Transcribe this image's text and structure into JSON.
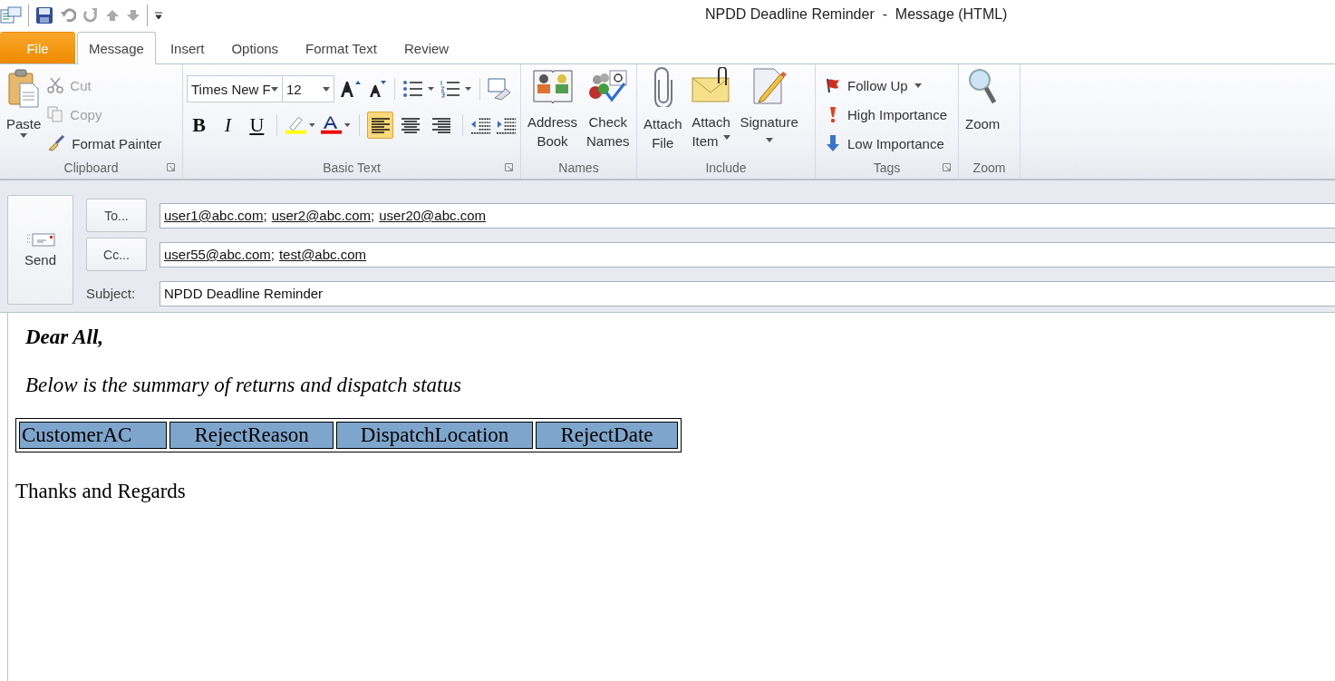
{
  "window": {
    "title": "NPDD Deadline Reminder  -  Message (HTML)"
  },
  "tabs": [
    {
      "label": "File",
      "kind": "file",
      "selected": false
    },
    {
      "label": "Message",
      "kind": "tab",
      "selected": true
    },
    {
      "label": "Insert",
      "kind": "tab",
      "selected": false
    },
    {
      "label": "Options",
      "kind": "tab",
      "selected": false
    },
    {
      "label": "Format Text",
      "kind": "tab",
      "selected": false
    },
    {
      "label": "Review",
      "kind": "tab",
      "selected": false
    }
  ],
  "clipboard": {
    "label": "Clipboard",
    "paste": "Paste",
    "items": [
      {
        "label": "Cut",
        "disabled": true
      },
      {
        "label": "Copy",
        "disabled": true
      },
      {
        "label": "Format Painter",
        "disabled": false
      }
    ]
  },
  "basic_text": {
    "label": "Basic Text",
    "font": "Times New F",
    "size": "12",
    "bold": "B",
    "italic": "I",
    "underline": "U",
    "alignment": [
      {
        "selected": true
      },
      {
        "selected": false
      },
      {
        "selected": false
      }
    ]
  },
  "names": {
    "label": "Names",
    "buttons": [
      [
        "Address",
        "Book"
      ],
      [
        "Check",
        "Names"
      ]
    ]
  },
  "include": {
    "label": "Include",
    "buttons": [
      {
        "lines": [
          "Attach",
          "File"
        ],
        "dropdown": false
      },
      {
        "lines": [
          "Attach",
          "Item"
        ],
        "dropdown": true
      },
      {
        "lines": [
          "Signature"
        ],
        "dropdown": true
      }
    ]
  },
  "tags": {
    "label": "Tags",
    "items": [
      {
        "label": "Follow Up",
        "dropdown": true
      },
      {
        "label": "High Importance",
        "dropdown": false
      },
      {
        "label": "Low Importance",
        "dropdown": false
      }
    ]
  },
  "zoom": {
    "label": "Zoom",
    "button": "Zoom"
  },
  "send": {
    "label": "Send"
  },
  "to": {
    "button": "To...",
    "separator": ";",
    "addresses": [
      "user1@abc.com",
      "user2@abc.com",
      "user20@abc.com"
    ]
  },
  "cc": {
    "button": "Cc...",
    "separator": ";",
    "addresses": [
      "user55@abc.com",
      "test@abc.com"
    ]
  },
  "subject": {
    "label": "Subject:",
    "value": "NPDD Deadline Reminder"
  },
  "body": {
    "greeting": "Dear All,",
    "intro": "Below is the summary of returns and dispatch status",
    "table": {
      "columns": [
        "CustomerAC",
        "RejectReason",
        "DispatchLocation",
        "RejectDate"
      ]
    },
    "closing": "Thanks and Regards"
  }
}
